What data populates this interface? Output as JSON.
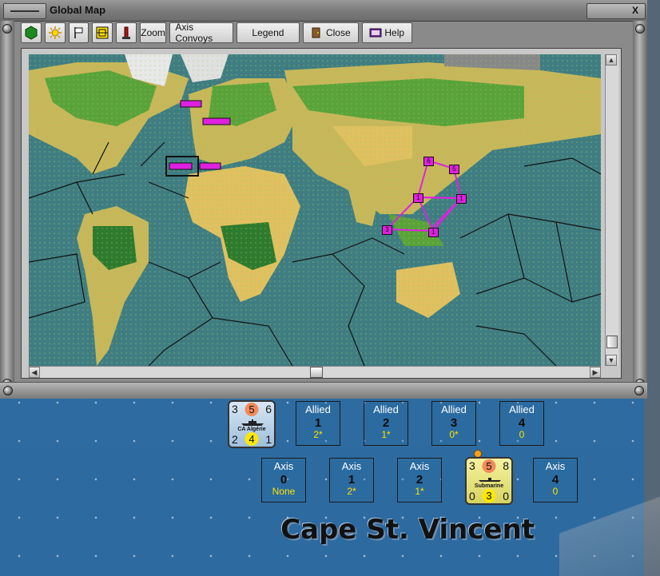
{
  "window": {
    "title": "Global Map",
    "close_icon": "X"
  },
  "toolbar": {
    "buttons": [
      {
        "icon": "green-hexagon-icon"
      },
      {
        "icon": "sun-burst-icon"
      },
      {
        "icon": "flag-icon"
      },
      {
        "icon": "grid-icon"
      },
      {
        "icon": "factory-chimney-icon"
      }
    ],
    "zoom_label": "Zoom",
    "axis_convoys_label": "Axis Convoys",
    "legend_label": "Legend",
    "close_label": "Close",
    "help_label": "Help"
  },
  "map": {
    "convoy_markers": [
      "5",
      "6",
      "1",
      "1",
      "3",
      "1"
    ],
    "route_color": "#e020e0",
    "marker_color": "#e020e0"
  },
  "allied_row": {
    "unit": {
      "name": "CA Algérie",
      "top_left": "3",
      "top_mid": "5",
      "top_right": "6",
      "bottom_left": "2",
      "bottom_mid": "4",
      "bottom_right": "1"
    },
    "boxes": [
      {
        "side": "Allied",
        "num": "1",
        "sub": "2*"
      },
      {
        "side": "Allied",
        "num": "2",
        "sub": "1*"
      },
      {
        "side": "Allied",
        "num": "3",
        "sub": "0*"
      },
      {
        "side": "Allied",
        "num": "4",
        "sub": "0"
      }
    ]
  },
  "axis_row": {
    "boxes_left": [
      {
        "side": "Axis",
        "num": "0",
        "sub": "None"
      },
      {
        "side": "Axis",
        "num": "1",
        "sub": "2*"
      },
      {
        "side": "Axis",
        "num": "2",
        "sub": "1*"
      }
    ],
    "unit": {
      "name": "Submarine",
      "top_left": "3",
      "top_mid": "5",
      "top_right": "8",
      "bottom_left": "0",
      "bottom_mid": "3",
      "bottom_right": "0"
    },
    "boxes_right": [
      {
        "side": "Axis",
        "num": "4",
        "sub": "0"
      }
    ]
  },
  "location": "Cape St. Vincent"
}
